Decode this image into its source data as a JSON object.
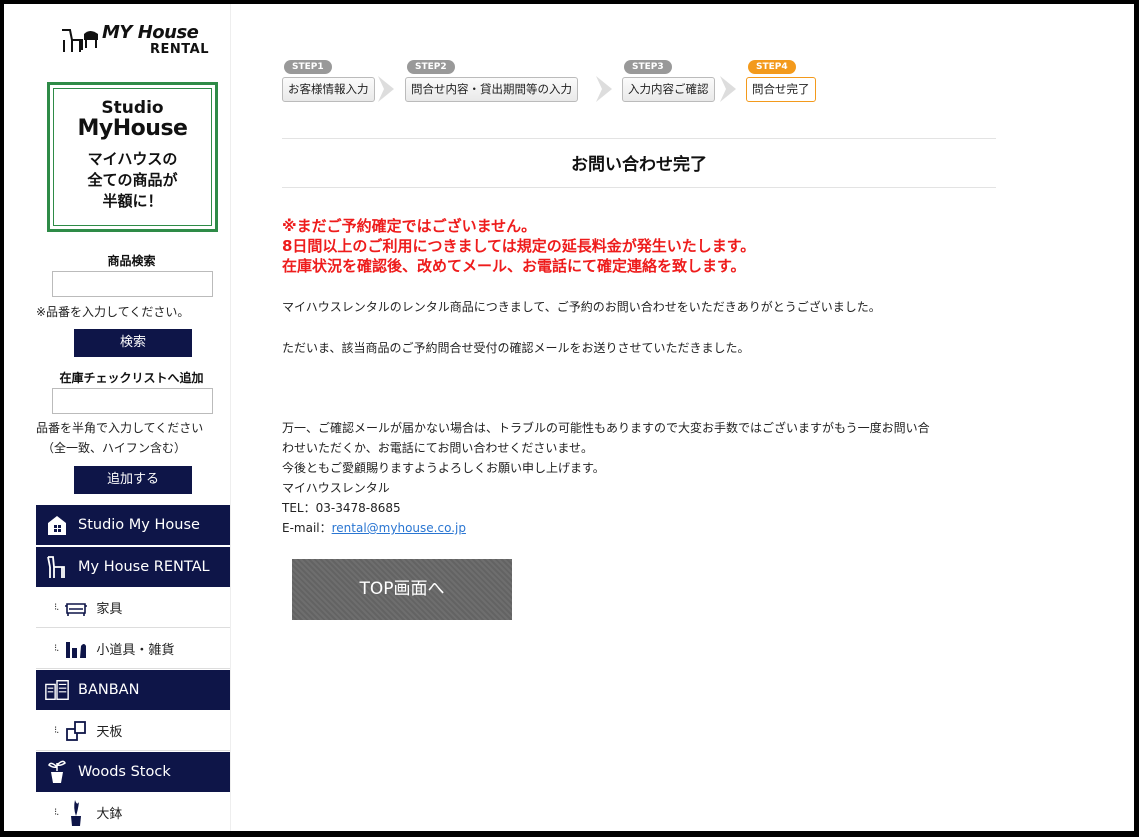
{
  "brand": {
    "logo_line1": "MY House",
    "logo_line2": "RENTAL"
  },
  "studio_ad": {
    "line1": "Studio",
    "line2": "MyHouse",
    "line3": "マイハウスの",
    "line4": "全ての商品が",
    "line5": "半額に！",
    "border_color": "#2e8b47"
  },
  "search": {
    "title": "商品検索",
    "note": "※品番を入力してください。",
    "button": "検索",
    "value": ""
  },
  "stock_check": {
    "title": "在庫チェックリストへ追加",
    "note_line1": "品番を半角で入力してください",
    "note_line2": "（全一致、ハイフン含む）",
    "button": "追加する",
    "value": ""
  },
  "menu": {
    "studio": "Studio My House",
    "rental": "My House RENTAL",
    "furniture": "家具",
    "props": "小道具・雑貨",
    "banban": "BANBAN",
    "tabletop": "天板",
    "woods": "Woods Stock",
    "pot": "大鉢"
  },
  "steps": [
    {
      "tag": "STEP1",
      "label": "お客様情報入力",
      "active": false
    },
    {
      "tag": "STEP2",
      "label": "問合せ内容・貸出期間等の入力",
      "active": false
    },
    {
      "tag": "STEP3",
      "label": "入力内容ご確認",
      "active": false
    },
    {
      "tag": "STEP4",
      "label": "問合せ完了",
      "active": true
    }
  ],
  "page": {
    "title": "お問い合わせ完了",
    "warning_line1": "※まだご予約確定ではございません。",
    "warning_line2": "8日間以上のご利用につきましては規定の延長料金が発生いたします。",
    "warning_line3": "在庫状況を確認後、改めてメール、お電話にて確定連絡を致します。",
    "thanks": "マイハウスレンタルのレンタル商品につきまして、ご予約のお問い合わせをいただきありがとうございました。",
    "confirm_sent": "ただいま、該当商品のご予約問合せ受付の確認メールをお送りさせていただきました。",
    "fallback_line1": "万一、ご確認メールが届かない場合は、トラブルの可能性もありますので大変お手数ではございますがもう一度お問い合",
    "fallback_line2": "わせいただくか、お電話にてお問い合わせくださいませ。",
    "closing": "今後ともご愛顧賜りますようよろしくお願い申し上げます。",
    "company": "マイハウスレンタル",
    "tel": "TEL：03-3478-8685",
    "email_label": "E-mail：",
    "email": "rental@myhouse.co.jp",
    "top_button": "TOP画面へ"
  },
  "colors": {
    "navy": "#0e1548",
    "warning_red": "#ee1c1c",
    "step_active": "#f39a1c",
    "link": "#2a76d2"
  }
}
